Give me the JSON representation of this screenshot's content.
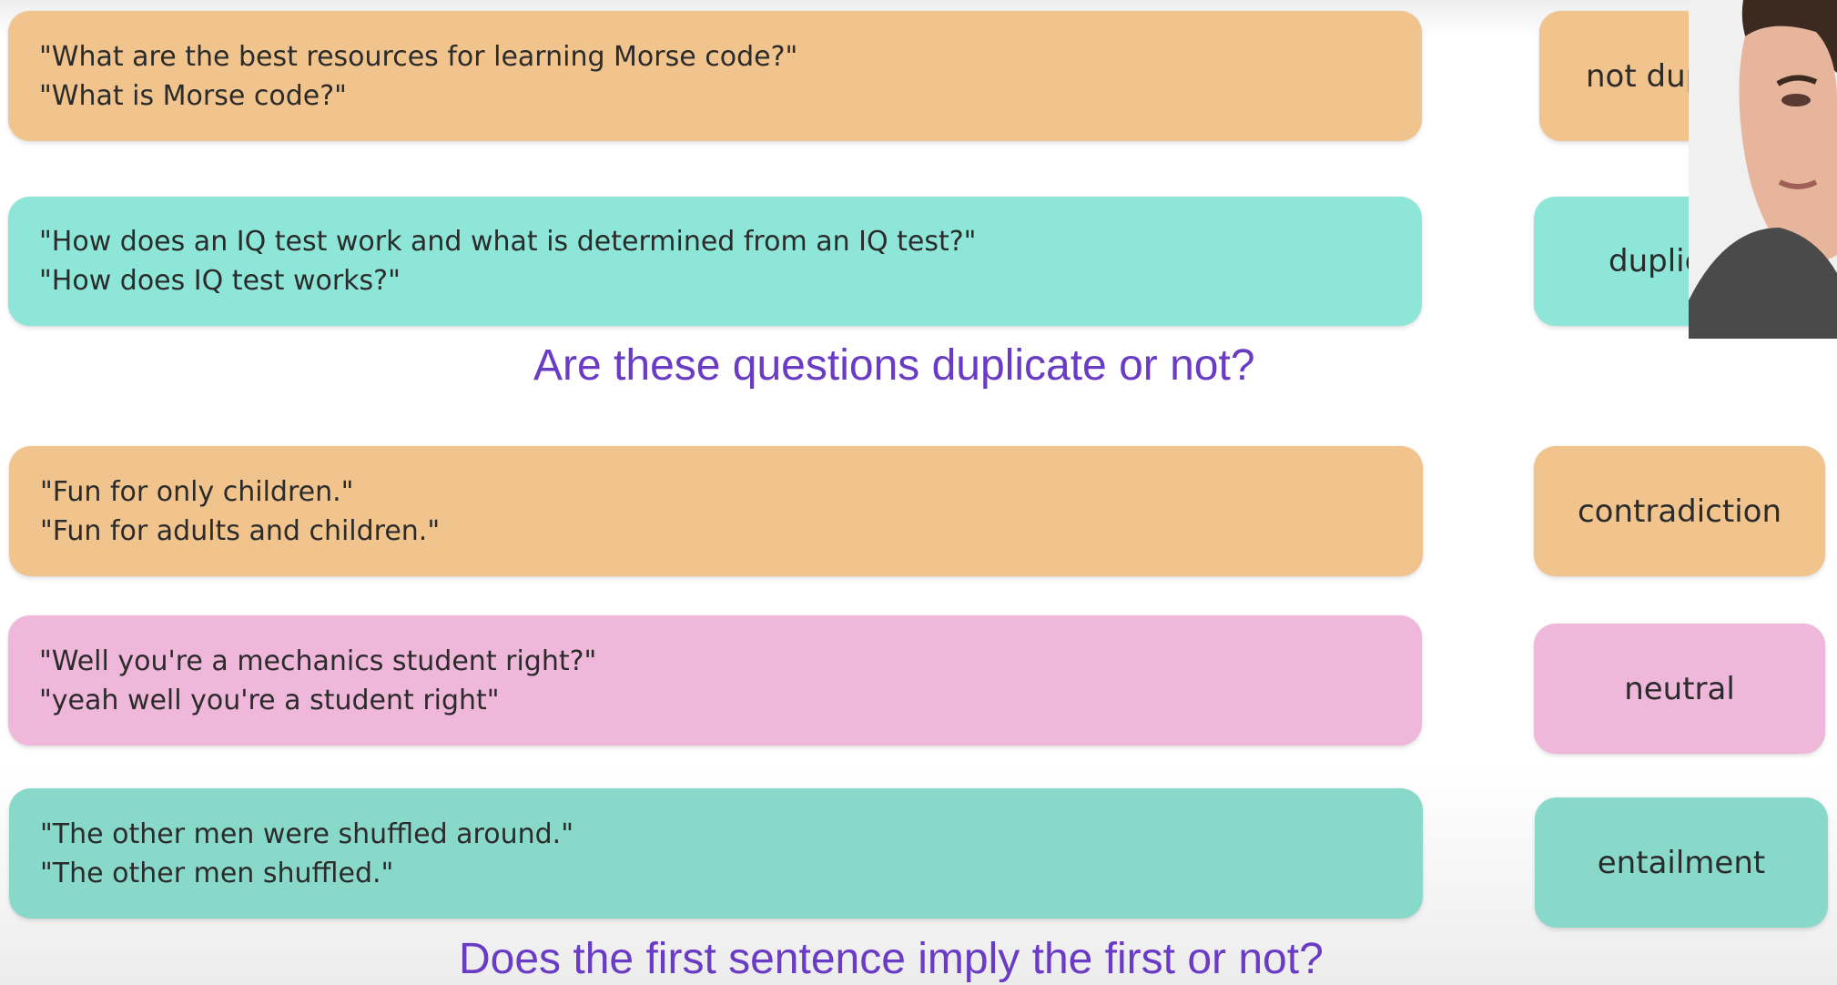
{
  "examples": [
    {
      "sentence1": "\"What are the best resources for learning Morse code?\"",
      "sentence2": "\"What is Morse code?\"",
      "label": "not duplicate"
    },
    {
      "sentence1": "\"How does an IQ test work and what is determined from an IQ test?\"",
      "sentence2": "\"How does IQ test works?\"",
      "label": "duplicate"
    },
    {
      "sentence1": "\"Fun for only children.\"",
      "sentence2": "\"Fun for adults and children.\"",
      "label": "contradiction"
    },
    {
      "sentence1": "\"Well you're a mechanics student right?\"",
      "sentence2": "\"yeah well you're a student right\"",
      "label": "neutral"
    },
    {
      "sentence1": "\"The other men were shuffled around.\"",
      "sentence2": "\"The other men shuffled.\"",
      "label": "entailment"
    }
  ],
  "questions": {
    "duplicate_question": "Are these questions duplicate or not?",
    "entailment_question": "Does the first sentence imply the first or not?"
  },
  "colors": {
    "orange": "#f2c48d",
    "teal": "#8de6d7",
    "pink": "#efb7d9",
    "question_text": "#6a3bc4"
  }
}
